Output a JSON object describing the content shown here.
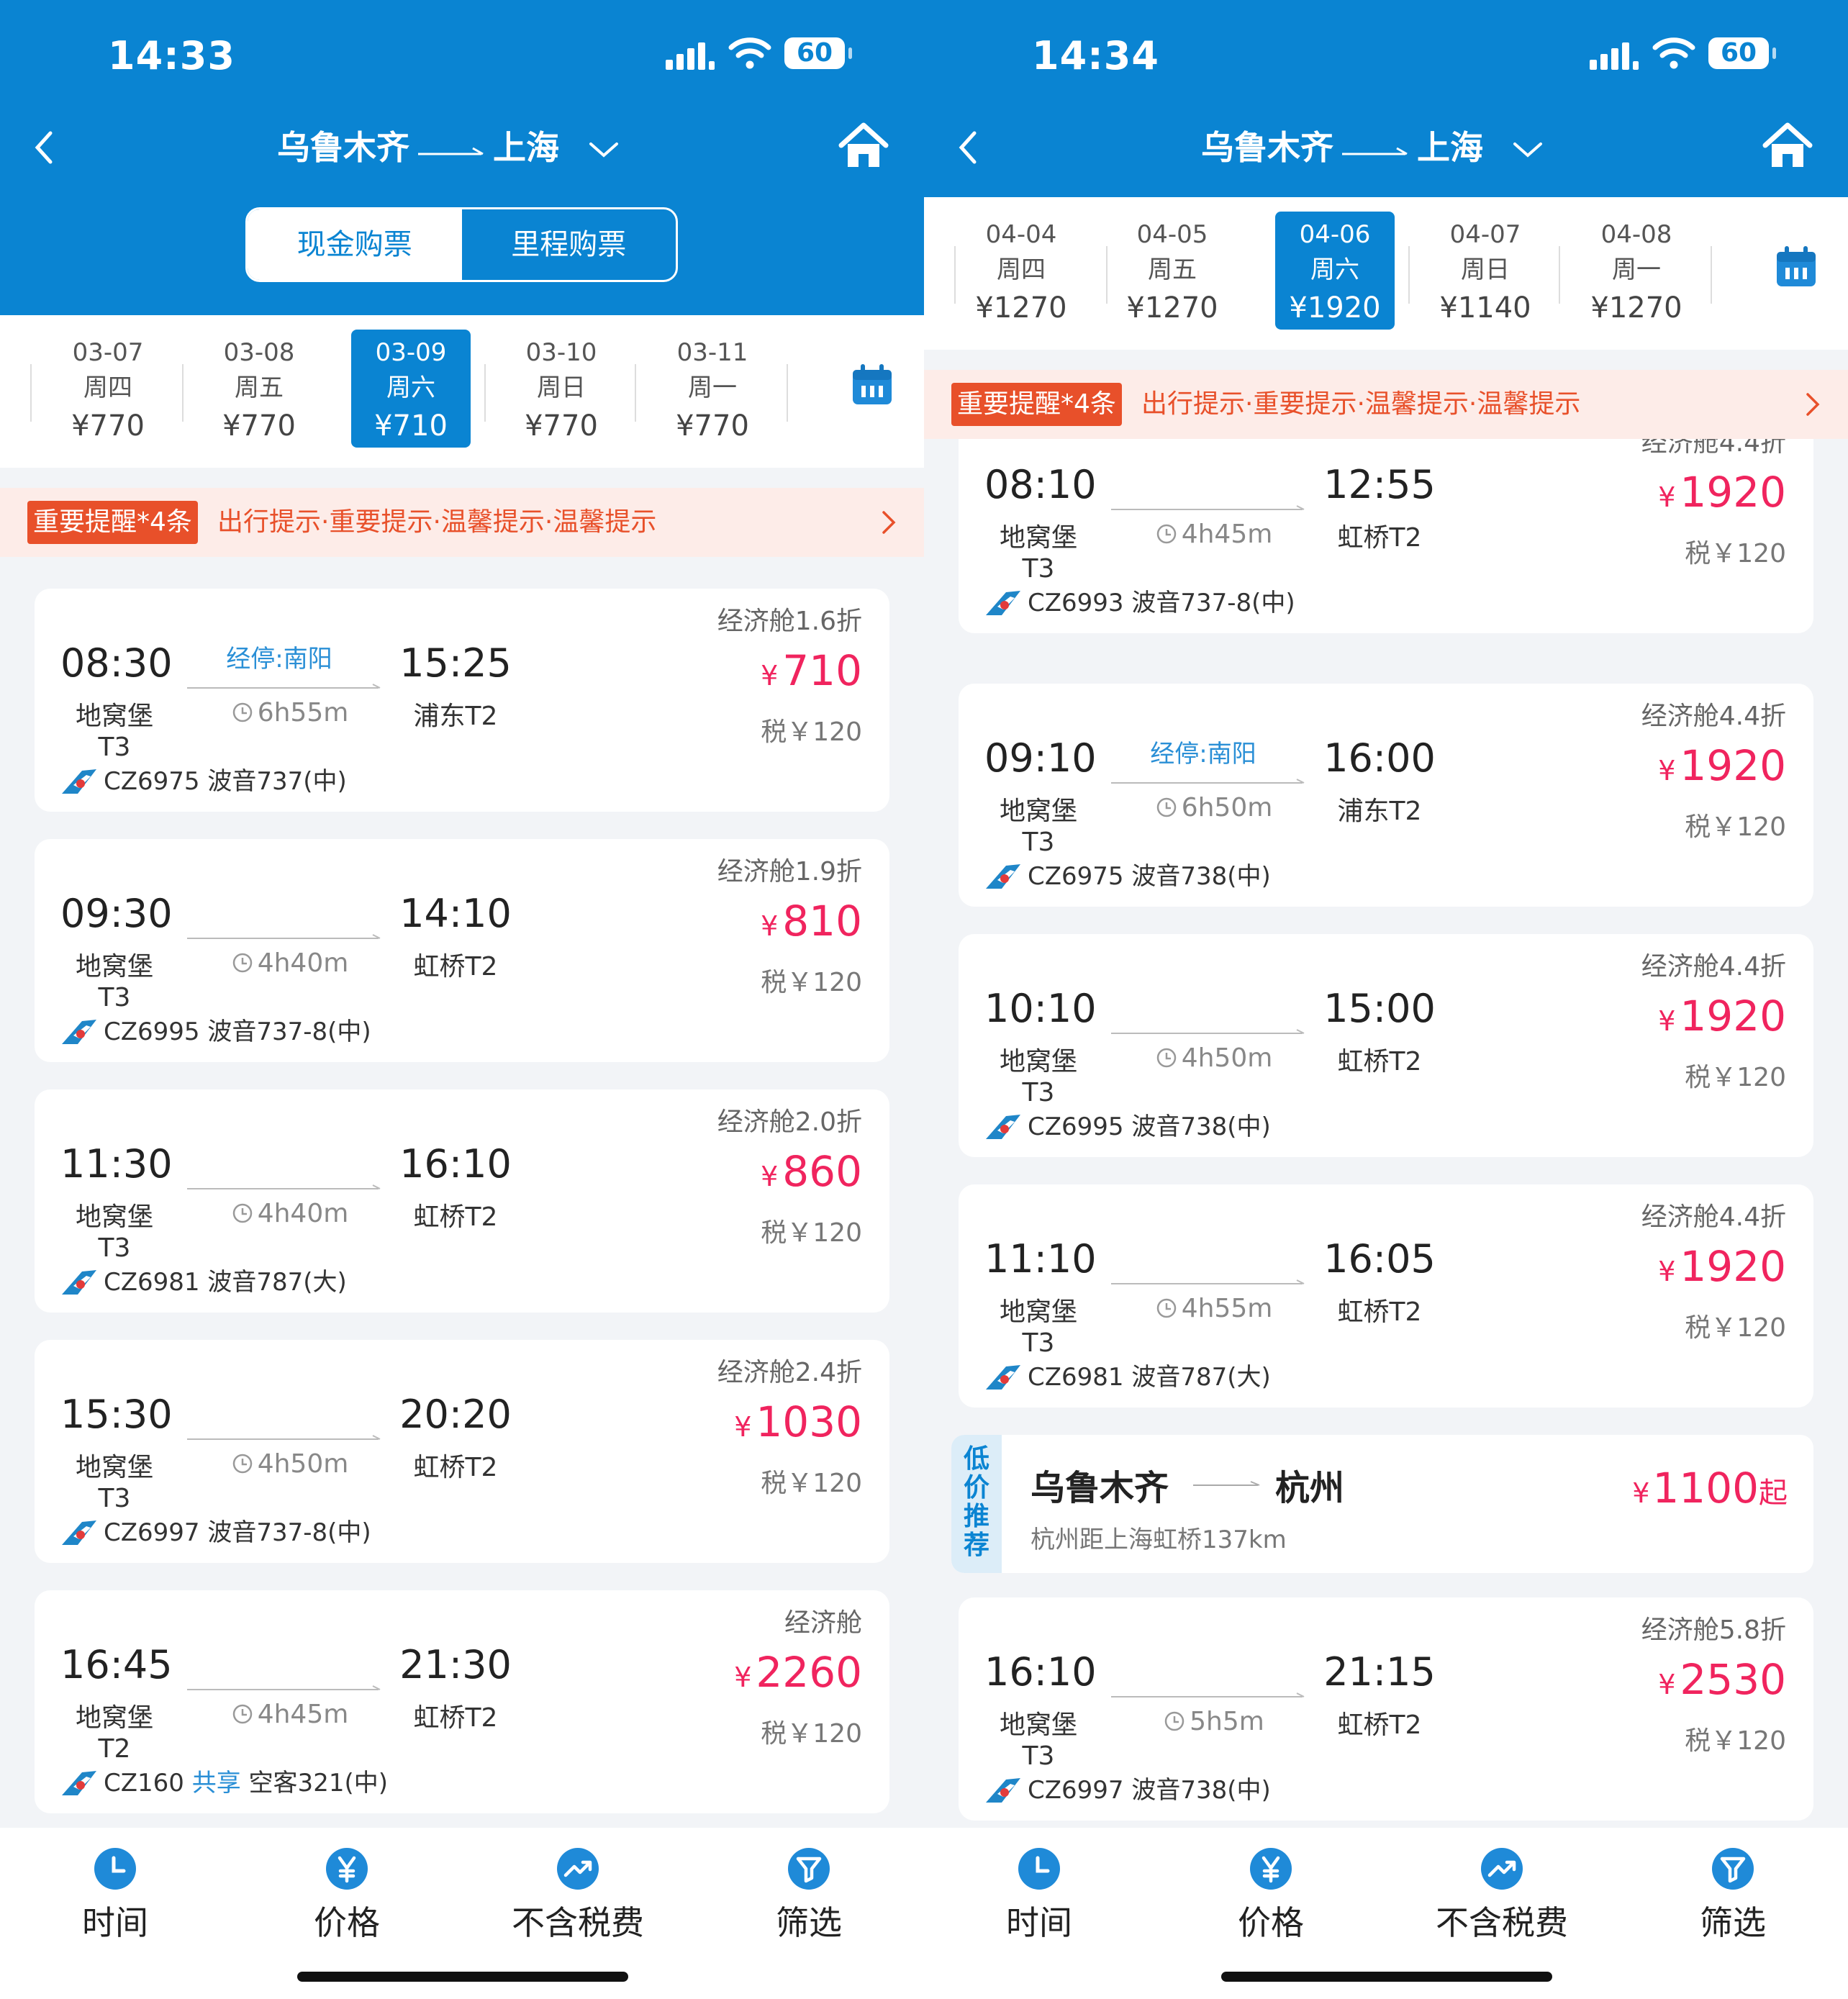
{
  "screens": [
    {
      "time": "14:33",
      "battery": "60",
      "route": {
        "from": "乌鲁木齐",
        "to": "上海"
      },
      "toggle": {
        "cash": "现金购票",
        "miles": "里程购票"
      },
      "dates": [
        {
          "date": "03-07",
          "weekday": "周四",
          "price": "¥770"
        },
        {
          "date": "03-08",
          "weekday": "周五",
          "price": "¥770"
        },
        {
          "date": "03-09",
          "weekday": "周六",
          "price": "¥710"
        },
        {
          "date": "03-10",
          "weekday": "周日",
          "price": "¥770"
        },
        {
          "date": "03-11",
          "weekday": "周一",
          "price": "¥770"
        }
      ],
      "notice": {
        "tag": "重要提醒*4条",
        "text": "出行提示·重要提示·温馨提示·温馨提示"
      },
      "flights": [
        {
          "discount": "经济舱1.6折",
          "dep_time": "08:30",
          "dep_airport": "地窝堡T3",
          "arr_time": "15:25",
          "arr_airport": "浦东T2",
          "via": "经停:南阳",
          "duration": "6h55m",
          "flight": "CZ6975 波音737(中)",
          "share": "",
          "price": "710",
          "tax": "税￥120"
        },
        {
          "discount": "经济舱1.9折",
          "dep_time": "09:30",
          "dep_airport": "地窝堡T3",
          "arr_time": "14:10",
          "arr_airport": "虹桥T2",
          "via": "",
          "duration": "4h40m",
          "flight": "CZ6995 波音737-8(中)",
          "share": "",
          "price": "810",
          "tax": "税￥120"
        },
        {
          "discount": "经济舱2.0折",
          "dep_time": "11:30",
          "dep_airport": "地窝堡T3",
          "arr_time": "16:10",
          "arr_airport": "虹桥T2",
          "via": "",
          "duration": "4h40m",
          "flight": "CZ6981 波音787(大)",
          "share": "",
          "price": "860",
          "tax": "税￥120"
        },
        {
          "discount": "经济舱2.4折",
          "dep_time": "15:30",
          "dep_airport": "地窝堡T3",
          "arr_time": "20:20",
          "arr_airport": "虹桥T2",
          "via": "",
          "duration": "4h50m",
          "flight": "CZ6997 波音737-8(中)",
          "share": "",
          "price": "1030",
          "tax": "税￥120"
        },
        {
          "discount": "经济舱",
          "dep_time": "16:45",
          "dep_airport": "地窝堡T2",
          "arr_time": "21:30",
          "arr_airport": "虹桥T2",
          "via": "",
          "duration": "4h45m",
          "flight_no": "CZ160",
          "share": "共享",
          "aircraft": "空客321(中)",
          "price": "2260",
          "tax": "税￥120"
        }
      ],
      "tabs": [
        "时间",
        "价格",
        "不含税费",
        "筛选"
      ]
    },
    {
      "time": "14:34",
      "battery": "60",
      "route": {
        "from": "乌鲁木齐",
        "to": "上海"
      },
      "dates": [
        {
          "date": "04-04",
          "weekday": "周四",
          "price": "¥1270"
        },
        {
          "date": "04-05",
          "weekday": "周五",
          "price": "¥1270"
        },
        {
          "date": "04-06",
          "weekday": "周六",
          "price": "¥1920"
        },
        {
          "date": "04-07",
          "weekday": "周日",
          "price": "¥1140"
        },
        {
          "date": "04-08",
          "weekday": "周一",
          "price": "¥1270"
        }
      ],
      "notice": {
        "tag": "重要提醒*4条",
        "text": "出行提示·重要提示·温馨提示·温馨提示"
      },
      "flights": [
        {
          "discount": "经济舱4.4折",
          "dep_time": "08:10",
          "dep_airport": "地窝堡T3",
          "arr_time": "12:55",
          "arr_airport": "虹桥T2",
          "via": "",
          "duration": "4h45m",
          "flight": "CZ6993 波音737-8(中)",
          "price": "1920",
          "tax": "税￥120"
        },
        {
          "discount": "经济舱4.4折",
          "dep_time": "09:10",
          "dep_airport": "地窝堡T3",
          "arr_time": "16:00",
          "arr_airport": "浦东T2",
          "via": "经停:南阳",
          "duration": "6h50m",
          "flight": "CZ6975 波音738(中)",
          "price": "1920",
          "tax": "税￥120"
        },
        {
          "discount": "经济舱4.4折",
          "dep_time": "10:10",
          "dep_airport": "地窝堡T3",
          "arr_time": "15:00",
          "arr_airport": "虹桥T2",
          "via": "",
          "duration": "4h50m",
          "flight": "CZ6995 波音738(中)",
          "price": "1920",
          "tax": "税￥120"
        },
        {
          "discount": "经济舱4.4折",
          "dep_time": "11:10",
          "dep_airport": "地窝堡T3",
          "arr_time": "16:05",
          "arr_airport": "虹桥T2",
          "via": "",
          "duration": "4h55m",
          "flight": "CZ6981 波音787(大)",
          "price": "1920",
          "tax": "税￥120"
        },
        {
          "discount": "经济舱5.8折",
          "dep_time": "16:10",
          "dep_airport": "地窝堡T3",
          "arr_time": "21:15",
          "arr_airport": "虹桥T2",
          "via": "",
          "duration": "5h5m",
          "flight": "CZ6997 波音738(中)",
          "price": "2530",
          "tax": "税￥120"
        }
      ],
      "promo": {
        "tag": "低价推荐",
        "from": "乌鲁木齐",
        "to": "杭州",
        "sub": "杭州距上海虹桥137km",
        "price": "1100",
        "suffix": "起"
      },
      "tabs": [
        "时间",
        "价格",
        "不含税费",
        "筛选"
      ]
    }
  ],
  "colors": {
    "brand": "#0a84d2",
    "price": "#f0245e",
    "notice": "#e8502a"
  }
}
